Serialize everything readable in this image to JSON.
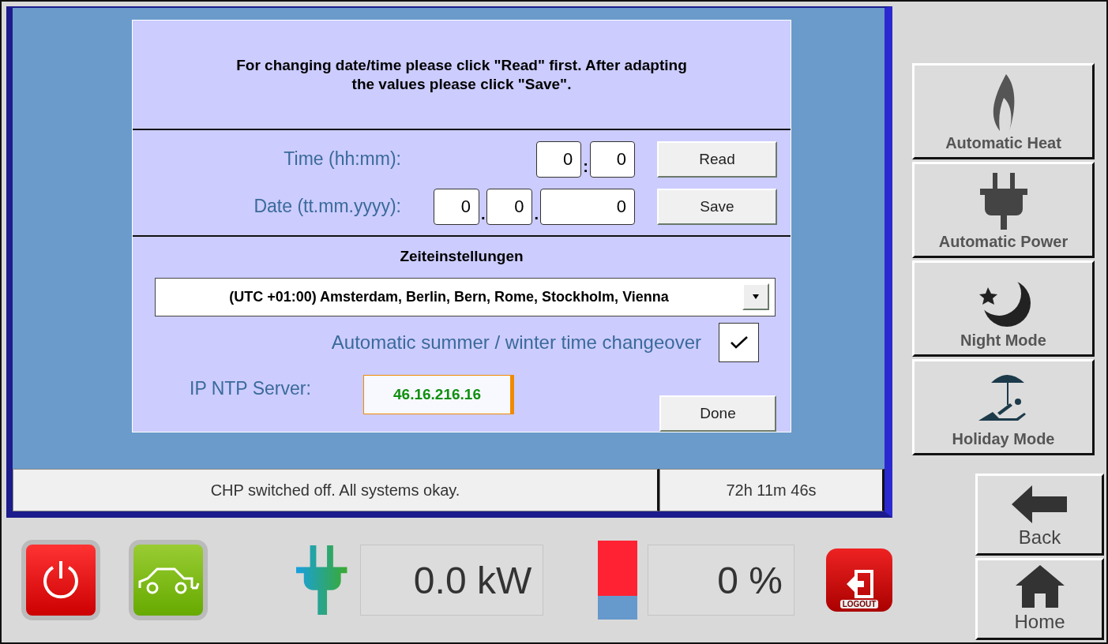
{
  "dialog": {
    "instruction": "For changing date/time please click \"Read\" first. After adapting the values please click \"Save\".",
    "time": {
      "label": "Time (hh:mm):",
      "fields": [
        "0",
        "0"
      ],
      "separators": [
        ":"
      ]
    },
    "date": {
      "label": "Date (tt.mm.yyyy):",
      "fields": [
        "0",
        "0",
        "0"
      ],
      "separators": [
        ".",
        "."
      ]
    },
    "read_button": "Read",
    "save_button": "Save",
    "section_title": "Zeiteinstellungen",
    "timezone": {
      "value": "(UTC +01:00) Amsterdam, Berlin, Bern, Rome, Stockholm, Vienna"
    },
    "dst": {
      "label": "Automatic summer / winter time changeover",
      "checked": true
    },
    "ntp": {
      "label": "IP NTP Server:",
      "value": "46.16.216.16"
    },
    "done_button": "Done"
  },
  "status_bar": {
    "message": "CHP switched off. All systems okay.",
    "runtime": "72h 11m 46s"
  },
  "modes": [
    {
      "kind": "heat",
      "label": "Automatic Heat"
    },
    {
      "kind": "power",
      "label": "Automatic Power"
    },
    {
      "kind": "night",
      "label": "Night Mode"
    },
    {
      "kind": "holiday",
      "label": "Holiday Mode"
    }
  ],
  "nav": [
    {
      "kind": "back",
      "label": "Back"
    },
    {
      "kind": "home",
      "label": "Home"
    }
  ],
  "bottom": {
    "power": "0.0 kW",
    "storage": {
      "level": 0.3,
      "reading": "0 %"
    },
    "logout": "LOGOUT"
  }
}
